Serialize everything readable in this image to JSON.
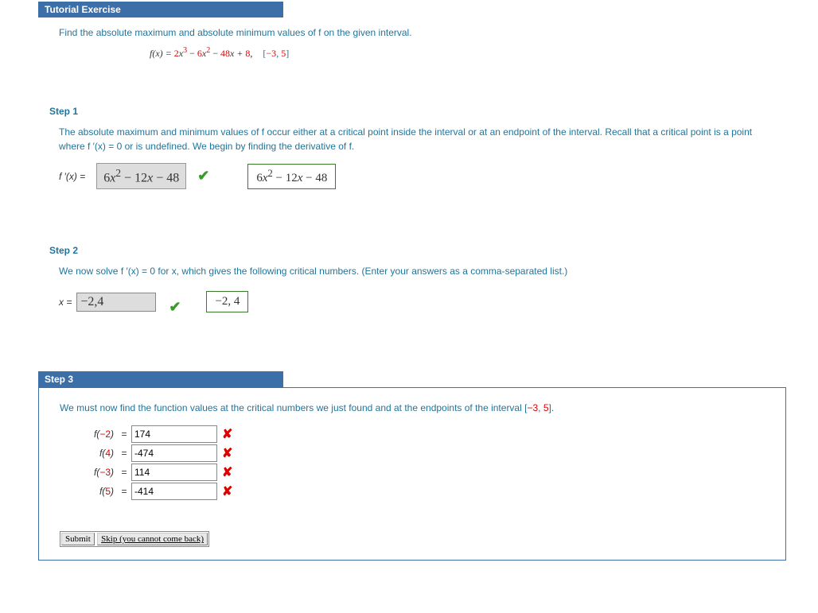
{
  "header": "Tutorial Exercise",
  "prompt": "Find the absolute maximum and absolute minimum values of f on the given interval.",
  "formula": {
    "lhs": "f(x) = ",
    "c1": "2",
    "t1": "x",
    "e1": "3",
    "op1": " − ",
    "c2": "6",
    "t2": "x",
    "e2": "2",
    "op2": " − ",
    "c3": "48",
    "t3": "x + ",
    "c4": "8",
    "comma": ",",
    "interval": "[−3, 5]"
  },
  "step1": {
    "label": "Step 1",
    "text": "The absolute maximum and minimum values of f occur either at a critical point inside the interval or at an endpoint of the interval. Recall that a critical point is a point where f ′(x) = 0 or is undefined. We begin by finding the derivative of f.",
    "lhs": "f ′(x) = ",
    "entered": "6x² − 12x − 48",
    "correct": "6x² − 12x − 48"
  },
  "step2": {
    "label": "Step 2",
    "text": "We now solve f ′(x) = 0 for x, which gives the following critical numbers. (Enter your answers as a comma-separated list.)",
    "lhs": "x = ",
    "entered": "−2,4",
    "correct": "−2, 4"
  },
  "step3": {
    "label": "Step 3",
    "text_a": "We must now find the function values at the critical numbers we just found and at the endpoints of the interval [",
    "text_lo": "−3",
    "text_mid": ", ",
    "text_hi": "5",
    "text_b": "].",
    "rows": [
      {
        "arg": "−2",
        "val": "174"
      },
      {
        "arg": "4",
        "val": "-474"
      },
      {
        "arg": "−3",
        "val": "114"
      },
      {
        "arg": "5",
        "val": "-414"
      }
    ]
  },
  "buttons": {
    "submit": "Submit",
    "skip": "Skip (you cannot come back)"
  }
}
